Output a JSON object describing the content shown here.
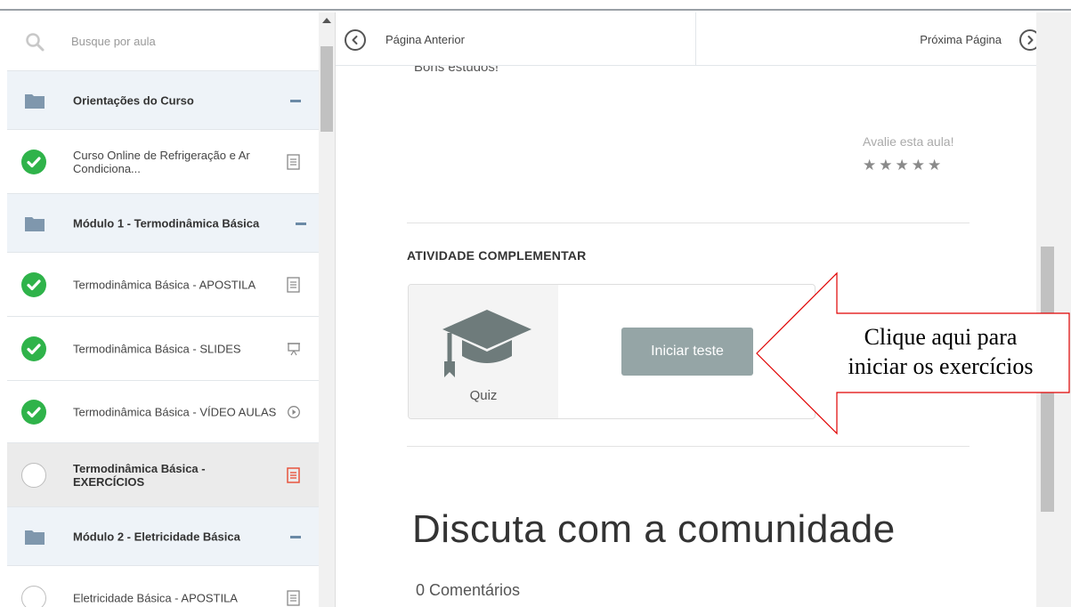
{
  "sidebar": {
    "search_placeholder": "Busque por aula",
    "items": [
      {
        "type": "section",
        "label": "Orientações do Curso"
      },
      {
        "type": "lesson",
        "label": "Curso Online de Refrigeração e Ar Condiciona...",
        "status": "done",
        "icon": "document-icon"
      },
      {
        "type": "section",
        "label": "Módulo 1 - Termodinâmica Básica"
      },
      {
        "type": "lesson",
        "label": "Termodinâmica Básica - APOSTILA",
        "status": "done",
        "icon": "document-icon"
      },
      {
        "type": "lesson",
        "label": "Termodinâmica Básica - SLIDES",
        "status": "done",
        "icon": "presentation-icon"
      },
      {
        "type": "lesson",
        "label": "Termodinâmica Básica - VÍDEO AULAS",
        "status": "done",
        "icon": "play-icon"
      },
      {
        "type": "lesson",
        "label": "Termodinâmica Básica - EXERCÍCIOS",
        "status": "pending",
        "icon": "document-icon",
        "active": true
      },
      {
        "type": "section",
        "label": "Módulo 2 - Eletricidade Básica"
      },
      {
        "type": "lesson",
        "label": "Eletricidade Básica - APOSTILA",
        "status": "pending",
        "icon": "document-icon"
      }
    ]
  },
  "nav": {
    "prev_label": "Página Anterior",
    "next_label": "Próxima Página"
  },
  "content": {
    "cut_text": "Bons estudos!",
    "rate_label": "Avalie esta aula!",
    "stars": "★★★★★",
    "rating_max": 5,
    "activity_title": "ATIVIDADE COMPLEMENTAR",
    "quiz_label": "Quiz",
    "start_button": "Iniciar teste",
    "discuss_title": "Discuta com a comunidade",
    "comments_count": "0 Comentários"
  },
  "annotation": {
    "line1": "Clique aqui para",
    "line2": "iniciar os exercícios"
  },
  "colors": {
    "check_green": "#2fb34a",
    "active_icon": "#e8553e",
    "button_gray": "#95a5a6",
    "arrow_red": "#e00000"
  }
}
